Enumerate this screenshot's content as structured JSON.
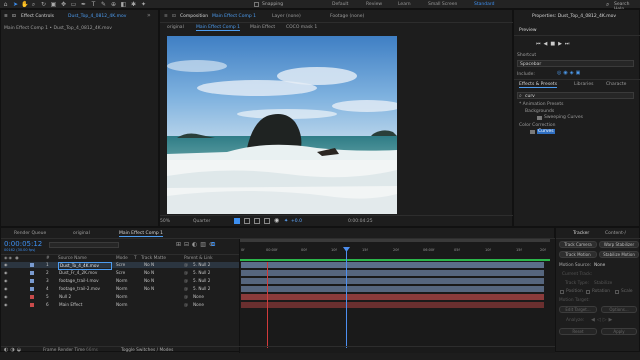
{
  "toolbar": {
    "snapping": "Snapping",
    "workspaces": [
      "Default",
      "Review",
      "Learn",
      "Small Screen",
      "Standard"
    ],
    "active_workspace": "Standard",
    "search_placeholder": "Search Help"
  },
  "left_panel": {
    "title": "Effect Controls",
    "file": "Dust_Top_4_0812_4K.mov",
    "path": "Main Effect Comp 1 • Dust_Top_4_0812_4K.mov"
  },
  "comp_panel": {
    "tab_label": "Composition",
    "tab_name": "Main Effect Comp 1",
    "layer_tab": "Layer (none)",
    "footage_tab": "Footage (none)",
    "subtabs": [
      "original",
      "Main Effect Comp 1",
      "Main Effect",
      "COCO mask 1"
    ],
    "zoom": "50%",
    "resolution": "Quarter",
    "exposure": "+0.0",
    "timecode": "0:00:04:25"
  },
  "right_panel": {
    "properties_title": "Properties: Dust_Top_4_0812_4K.mov",
    "preview_tab": "Preview",
    "shortcut_label": "Shortcut",
    "shortcut_value": "Spacebar",
    "include_label": "Include:",
    "tabs": [
      "Effects & Presets",
      "Libraries",
      "Characte"
    ],
    "search_value": "curv",
    "tree": [
      {
        "label": "* Animation Presets",
        "indent": 0
      },
      {
        "label": "Backgrounds",
        "indent": 1
      },
      {
        "label": "Sweeping Curves",
        "indent": 2
      },
      {
        "label": "Color Correction",
        "indent": 0
      },
      {
        "label": "Curves",
        "indent": 1
      }
    ]
  },
  "timeline": {
    "tabs": [
      "Render Queue",
      "original",
      "Main Effect Comp 1"
    ],
    "timecode": "0:00:05:12",
    "frame_info": "00162 (30.00 fps)",
    "columns": [
      "#",
      "Source Name",
      "Mode",
      "T",
      "Track Matte",
      "Parent & Link"
    ],
    "layers": [
      {
        "num": "1",
        "name": "Dust_To_4_4K.mov",
        "mode": "Scre",
        "matte": "No N",
        "parent": "5. Null 2",
        "color": "#7a9bd0"
      },
      {
        "num": "2",
        "name": "Dust_Fr_4_2K.mov",
        "mode": "Scre",
        "matte": "No N",
        "parent": "5. Null 2",
        "color": "#7a9bd0"
      },
      {
        "num": "3",
        "name": "footage_trail-I.mov",
        "mode": "Norm",
        "matte": "No N",
        "parent": "5. Null 2",
        "color": "#7a9bd0"
      },
      {
        "num": "4",
        "name": "footage_trail-2.mov",
        "mode": "Norm",
        "matte": "No N",
        "parent": "5. Null 2",
        "color": "#7a9bd0"
      },
      {
        "num": "5",
        "name": "Null 2",
        "mode": "Norm",
        "matte": "No N",
        "parent": "None",
        "color": "#c94b4b"
      },
      {
        "num": "6",
        "name": "Main Effect",
        "mode": "Norm",
        "matte": "No N",
        "parent": "None",
        "color": "#c94b4b"
      }
    ],
    "ruler": [
      "0f",
      "00:00f",
      "00f",
      "10f",
      "15f",
      "20f",
      "06:00f",
      "05f",
      "10f",
      "15f",
      "20f"
    ],
    "footer_left": "Frame Render Time",
    "footer_render_value": "66ms",
    "footer_mid": "Toggle Switches / Modes"
  },
  "tracker": {
    "tabs": [
      "Tracker",
      "Content-/"
    ],
    "buttons": [
      "Track Camera",
      "Warp Stabilizer",
      "Track Motion",
      "Stabilize Motion"
    ],
    "motion_source_label": "Motion Source:",
    "motion_source_value": "None",
    "current_track": "Current Track:",
    "track_type": "Track Type:",
    "track_type_value": "Stabilize",
    "checks": [
      "Position",
      "Rotation",
      "Scale"
    ],
    "motion_target": "Motion Target:",
    "edit_target": "Edit Target...",
    "options": "Options...",
    "analyze": "Analyze:",
    "reset": "Reset",
    "apply": "Apply"
  },
  "colors": {
    "accent": "#3d8ff0",
    "work_area": "#2bb64a",
    "playhead": "#4d8ff0",
    "red_marker": "#d13b3b"
  }
}
